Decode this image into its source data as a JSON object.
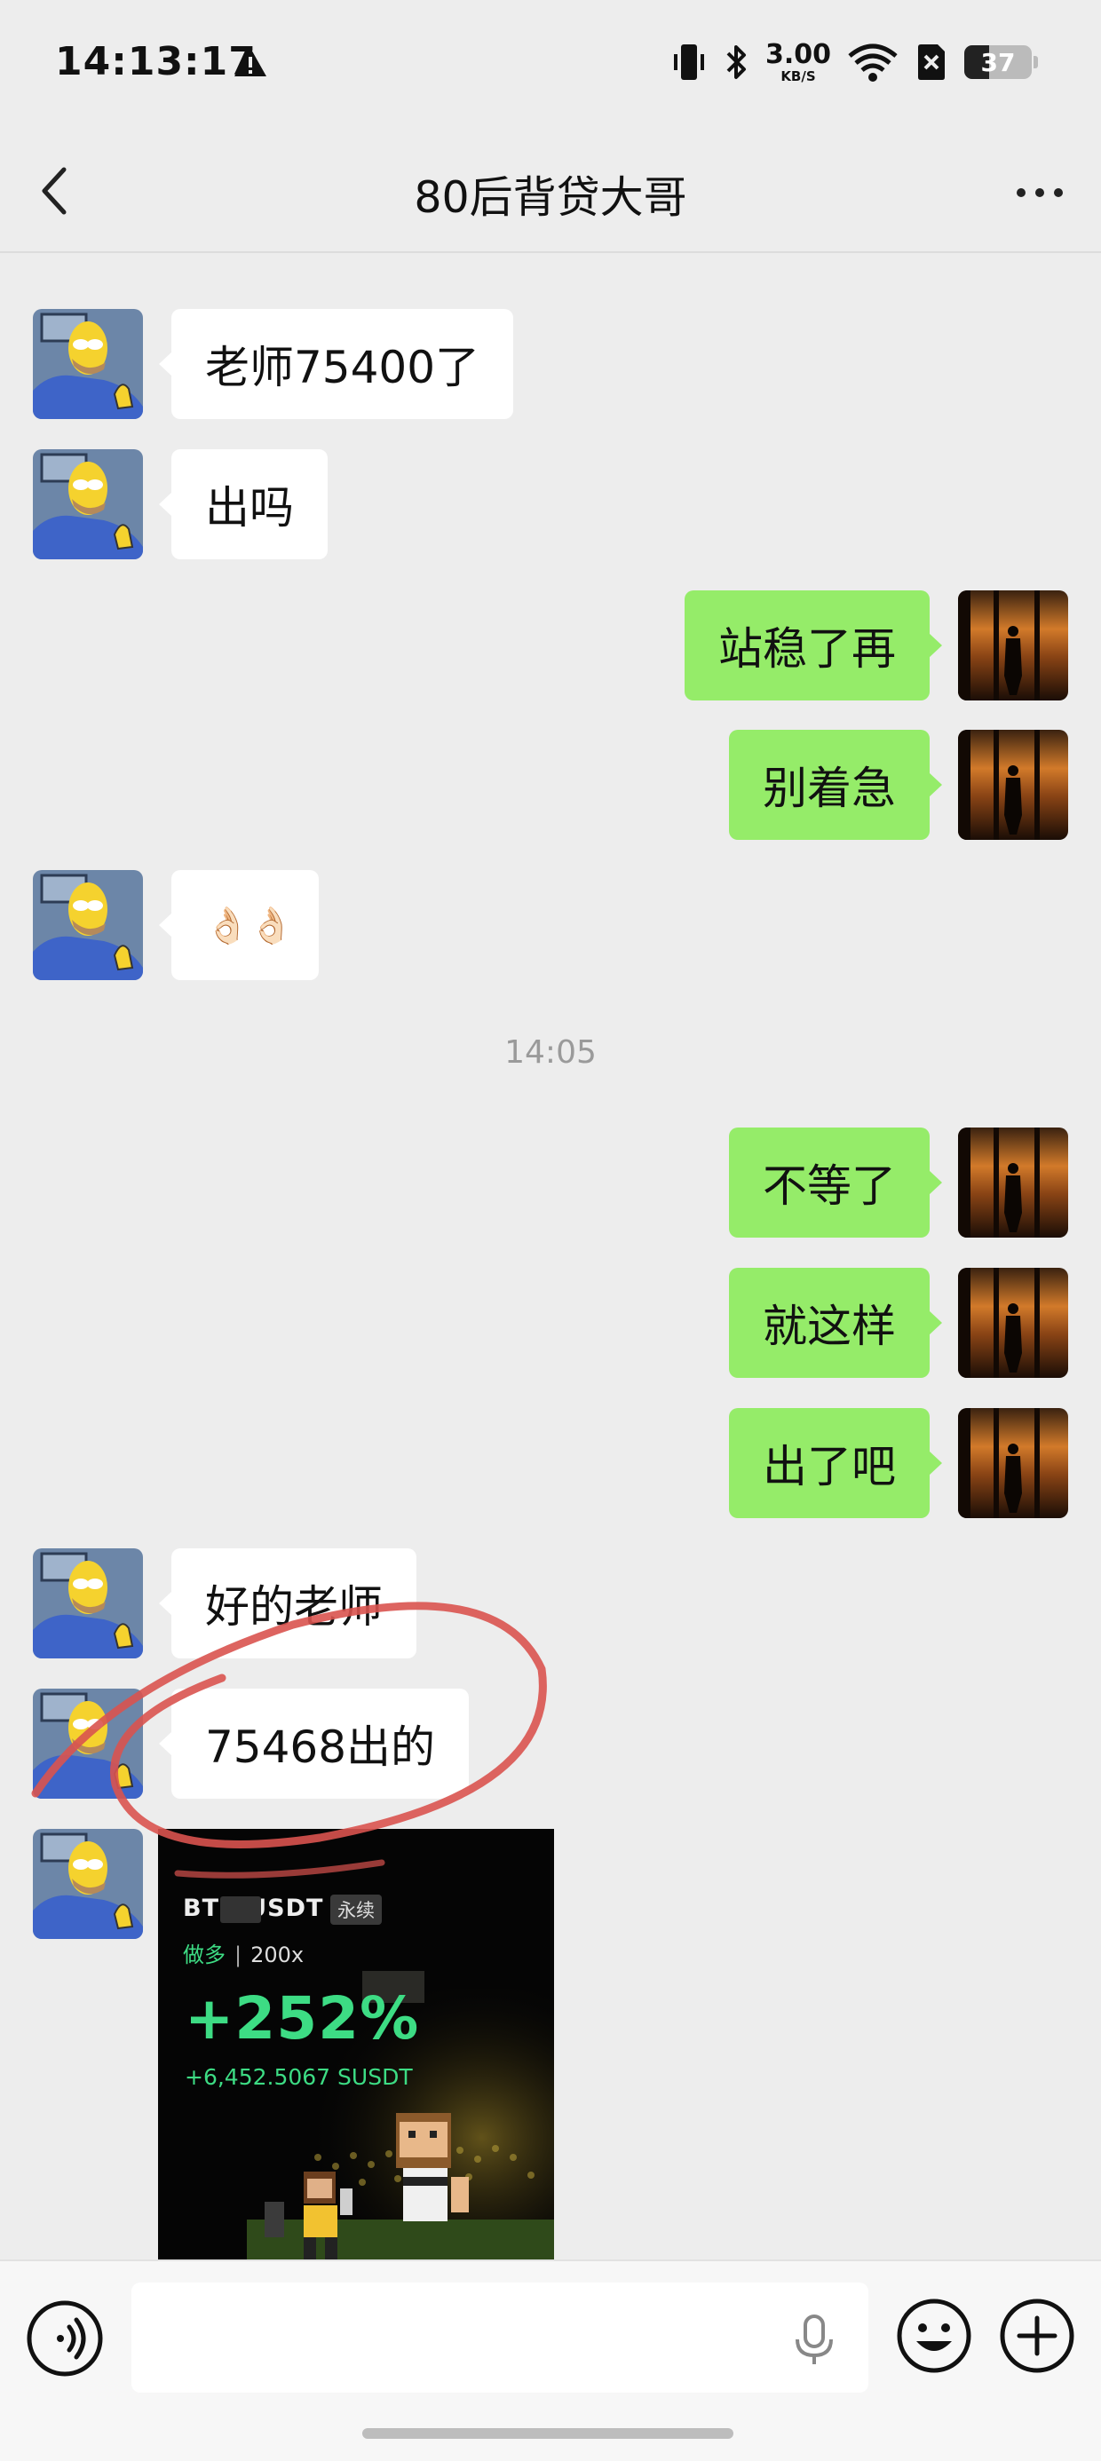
{
  "status_bar": {
    "time": "14:13:17",
    "net_speed_value": "3.00",
    "net_speed_unit": "KB/S",
    "battery": "37",
    "battery_level_fraction": 0.37,
    "icons": [
      "alert-triangle-icon",
      "vibrate-icon",
      "bluetooth-icon",
      "wifi-icon",
      "no-sim-icon",
      "battery-icon"
    ]
  },
  "header": {
    "title": "80后背贷大哥",
    "back_icon": "chevron-left-icon",
    "more_icon": "more-dots-icon"
  },
  "messages": [
    {
      "side": "in",
      "text": "老师75400了"
    },
    {
      "side": "in",
      "text": "出吗"
    },
    {
      "side": "out",
      "text": "站稳了再"
    },
    {
      "side": "out",
      "text": "别着急"
    },
    {
      "side": "in",
      "text": "👌🏻👌🏻"
    },
    {
      "type": "time",
      "text": "14:05"
    },
    {
      "side": "out",
      "text": "不等了"
    },
    {
      "side": "out",
      "text": "就这样"
    },
    {
      "side": "out",
      "text": "出了吧"
    },
    {
      "side": "in",
      "text": "好的老师"
    },
    {
      "side": "in",
      "text": "75468出的"
    }
  ],
  "image_card": {
    "pair": "BTC USDT",
    "tag": "永续",
    "direction": "做多",
    "separator": "|",
    "leverage": "200x",
    "roi": "+252%",
    "pnl": "+6,452.5067 SUSDT"
  },
  "input_bar": {
    "placeholder": "",
    "icons": [
      "voice-mode-icon",
      "microphone-icon",
      "emoji-icon",
      "plus-icon"
    ]
  },
  "colors": {
    "background": "#ededed",
    "bubble_in": "#ffffff",
    "bubble_out": "#95ec69",
    "profit_green": "#3ddc84",
    "annotation_red": "#d9534f"
  }
}
